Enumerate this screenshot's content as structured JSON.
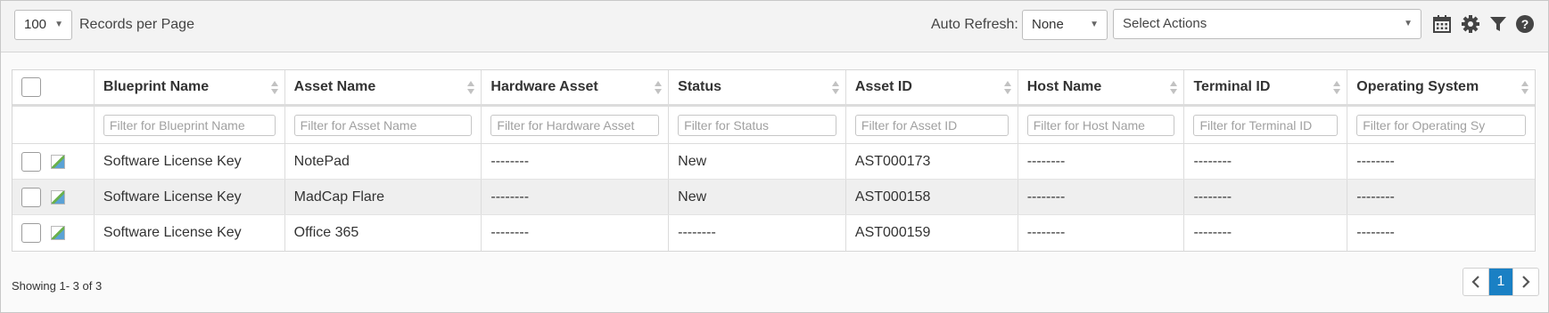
{
  "toolbar": {
    "records_per_page_value": "100",
    "records_per_page_label": "Records per Page",
    "auto_refresh_label": "Auto Refresh:",
    "auto_refresh_value": "None",
    "actions_placeholder": "Select Actions",
    "icons": [
      "calendar-icon",
      "gear-icon",
      "filter-icon",
      "help-icon"
    ]
  },
  "table": {
    "columns": [
      {
        "label": "Blueprint Name",
        "filter": "Filter for Blueprint Name"
      },
      {
        "label": "Asset Name",
        "filter": "Filter for Asset Name"
      },
      {
        "label": "Hardware Asset",
        "filter": "Filter for Hardware Asset"
      },
      {
        "label": "Status",
        "filter": "Filter for Status"
      },
      {
        "label": "Asset ID",
        "filter": "Filter for Asset ID"
      },
      {
        "label": "Host Name",
        "filter": "Filter for Host Name"
      },
      {
        "label": "Terminal ID",
        "filter": "Filter for Terminal ID"
      },
      {
        "label": "Operating System",
        "filter": "Filter for Operating Sy"
      }
    ],
    "rows": [
      {
        "cells": [
          "Software License Key",
          "NotePad",
          "--------",
          "New",
          "AST000173",
          "--------",
          "--------",
          "--------"
        ]
      },
      {
        "cells": [
          "Software License Key",
          "MadCap Flare",
          "--------",
          "New",
          "AST000158",
          "--------",
          "--------",
          "--------"
        ]
      },
      {
        "cells": [
          "Software License Key",
          "Office 365",
          "--------",
          "--------",
          "AST000159",
          "--------",
          "--------",
          "--------"
        ]
      }
    ]
  },
  "footer": {
    "showing_text": "Showing 1- 3 of 3",
    "current_page": "1"
  },
  "colors": {
    "accent": "#1a80c4",
    "toolbar_bg": "#f3f3f3",
    "alt_row_bg": "#efefef"
  }
}
